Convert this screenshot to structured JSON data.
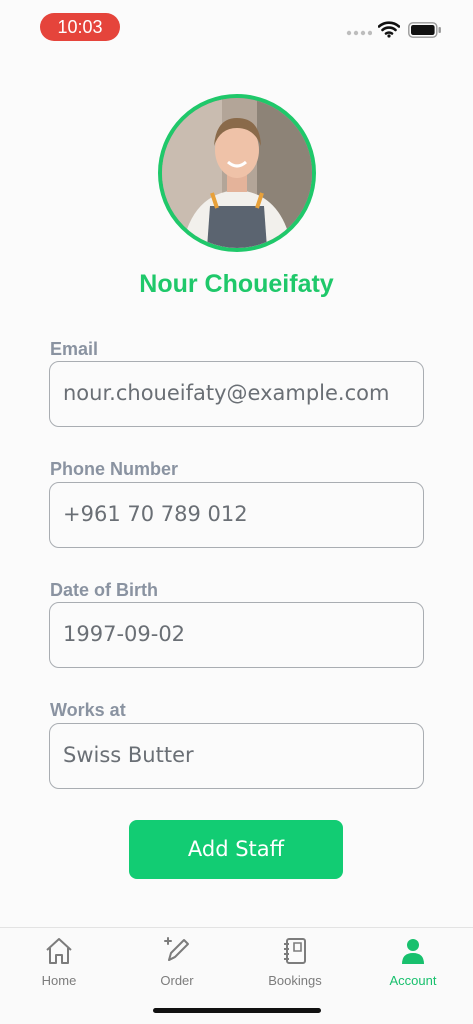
{
  "status_bar": {
    "time": "10:03"
  },
  "profile": {
    "name": "Nour Choueifaty"
  },
  "form": {
    "fields": [
      {
        "label": "Email",
        "value": "nour.choueifaty@example.com"
      },
      {
        "label": "Phone Number",
        "value": "+961 70 789 012"
      },
      {
        "label": "Date of Birth",
        "value": "1997-09-02"
      },
      {
        "label": "Works at",
        "value": "Swiss Butter"
      }
    ],
    "submit_label": "Add Staff"
  },
  "tab_bar": {
    "tabs": [
      {
        "label": "Home",
        "icon": "home-icon",
        "active": false
      },
      {
        "label": "Order",
        "icon": "pencil-icon",
        "active": false
      },
      {
        "label": "Bookings",
        "icon": "notebook-icon",
        "active": false
      },
      {
        "label": "Account",
        "icon": "person-icon",
        "active": true
      }
    ]
  },
  "colors": {
    "accent": "#1fc86a",
    "button": "#12cc73",
    "time_pill": "#e5443b",
    "label": "#8a93a1",
    "inactive_tab": "#7c7c7c"
  }
}
